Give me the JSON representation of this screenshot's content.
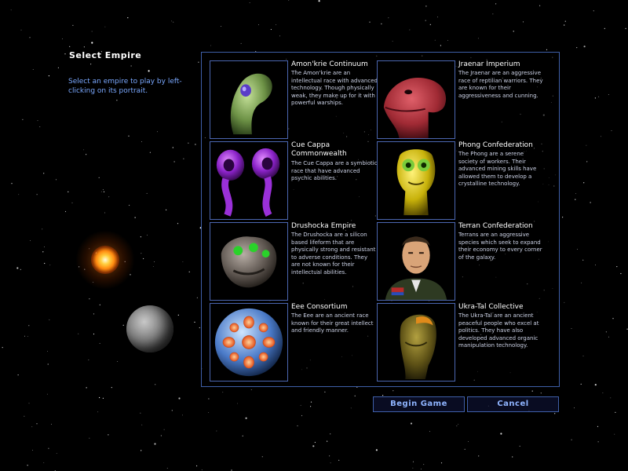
{
  "sidebar": {
    "title": "Select Empire",
    "instructions": "Select an empire to play by left-clicking on its portrait."
  },
  "empires": [
    {
      "name": "Amon'krie Continuum",
      "description": "The Amon'krie are an intellectual race with advanced technology. Though physically weak, they make up for it with powerful warships."
    },
    {
      "name": "Jraenar Imperium",
      "description": "The Jraenar are an aggressive race of reptilian warriors. They are known for their aggressiveness and cunning."
    },
    {
      "name": "Cue Cappa Commonwealth",
      "description": "The Cue Cappa are a symbiotic race that have advanced psychic abilities."
    },
    {
      "name": "Phong Confederation",
      "description": "The Phong are a serene society of workers. Their advanced mining skills have allowed them to develop a crystalline technology."
    },
    {
      "name": "Drushocka Empire",
      "description": "The Drushocka are a silicon based lifeform that are physically strong and resistant to adverse conditions. They are not known for their intellectual abilities."
    },
    {
      "name": "Terran Confederation",
      "description": "Terrans are an aggressive species which seek to expand their economy to every corner of the galaxy."
    },
    {
      "name": "Eee Consortium",
      "description": "The Eee are an ancient race known for their great intellect and friendly manner."
    },
    {
      "name": "Ukra-Tal Collective",
      "description": "The Ukra-Tal are an ancient peaceful people who excel at politics. They have also developed advanced organic manipulation technology."
    }
  ],
  "buttons": {
    "begin": "Begin Game",
    "cancel": "Cancel"
  },
  "colors": {
    "accent": "#8fb4ff",
    "border": "#3f5fa8",
    "instruction_text": "#7aa8ff"
  }
}
